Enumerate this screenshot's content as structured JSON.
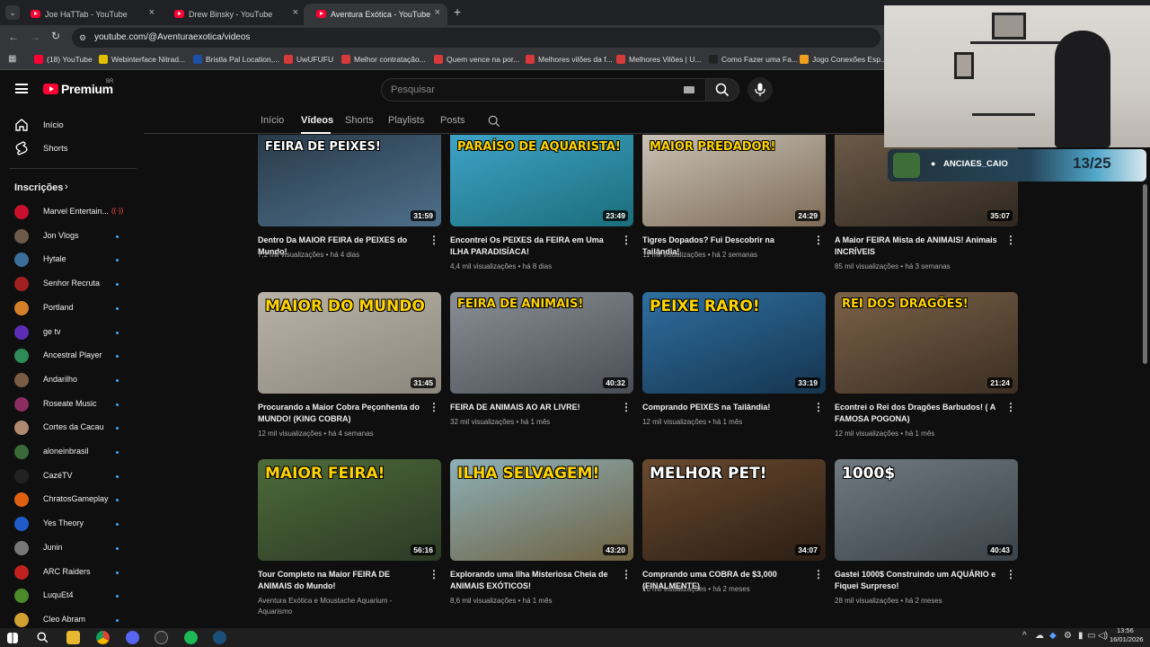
{
  "browser": {
    "tabs": [
      {
        "title": "Joe HaTTab - YouTube"
      },
      {
        "title": "Drew Binsky - YouTube"
      },
      {
        "title": "Aventura Exótica - YouTube"
      }
    ],
    "url": "youtube.com/@Aventuraexotica/videos",
    "bookmarks": [
      {
        "label": "(18) YouTube",
        "color": "#ff0033"
      },
      {
        "label": "Webinterface Nitrad...",
        "color": "#e0c000"
      },
      {
        "label": "Bristla Pal Location,...",
        "color": "#1e4fa5"
      },
      {
        "label": "UwUFUFU",
        "color": "#d63a3a"
      },
      {
        "label": "Melhor contratação...",
        "color": "#d63a3a"
      },
      {
        "label": "Quem vence na por...",
        "color": "#d63a3a"
      },
      {
        "label": "Melhores vilões da f...",
        "color": "#d63a3a"
      },
      {
        "label": "Melhores Vilões | U...",
        "color": "#d63a3a"
      },
      {
        "label": "Como Fazer uma Fa...",
        "color": "#222222"
      },
      {
        "label": "Jogo Conexões Esp...",
        "color": "#f0a020"
      }
    ]
  },
  "youtube": {
    "logo": "Premium",
    "logo_region": "BR",
    "search_placeholder": "Pesquisar",
    "sidebar": {
      "home": "Início",
      "shorts": "Shorts",
      "subscriptions_header": "Inscrições",
      "channels": [
        {
          "name": "Marvel Entertain...",
          "color": "#c8102e",
          "live": true
        },
        {
          "name": "Jon Vlogs",
          "color": "#6b5a4a",
          "live": false
        },
        {
          "name": "Hytale",
          "color": "#3c6e9c",
          "live": false
        },
        {
          "name": "Senhor Recruta",
          "color": "#a32020",
          "live": false
        },
        {
          "name": "Portland",
          "color": "#d4802a",
          "live": false
        },
        {
          "name": "ge tv",
          "color": "#5b2db5",
          "live": false
        },
        {
          "name": "Ancestral Player",
          "color": "#2e8b57",
          "live": false
        },
        {
          "name": "Andarilho",
          "color": "#7a5c45",
          "live": false
        },
        {
          "name": "Roseate Music",
          "color": "#8a2d5e",
          "live": false
        },
        {
          "name": "Cortes da Cacau",
          "color": "#b08a70",
          "live": false
        },
        {
          "name": "aloneinbrasil",
          "color": "#3a6a3a",
          "live": false
        },
        {
          "name": "CazéTV",
          "color": "#222222",
          "live": false
        },
        {
          "name": "ChratosGameplay",
          "color": "#e06010",
          "live": false
        },
        {
          "name": "Yes Theory",
          "color": "#1f5cc9",
          "live": false
        },
        {
          "name": "Junin",
          "color": "#777777",
          "live": false
        },
        {
          "name": "ARC Raiders",
          "color": "#c02020",
          "live": false
        },
        {
          "name": "LuquEt4",
          "color": "#4a8a2a",
          "live": false
        },
        {
          "name": "Cleo Abram",
          "color": "#d0a030",
          "live": false
        }
      ]
    },
    "channel_tabs": [
      "Início",
      "Vídeos",
      "Shorts",
      "Playlists",
      "Posts"
    ],
    "videos": [
      {
        "title": "Dentro Da MAIOR FEIRA de PEIXES do Mundo!",
        "views": "7,2 mil visualizações",
        "age": "há 4 dias",
        "duration": "31:59",
        "overlay": "FEIRA DE PEIXES!",
        "bg": [
          "#2a3b4a",
          "#4d6f8a"
        ]
      },
      {
        "title": "Encontrei Os PEIXES da FEIRA em Uma ILHA PARADISÍACA!",
        "views": "4,4 mil visualizações",
        "age": "há 8 dias",
        "duration": "23:49",
        "overlay": "PARAÍSO DE AQUARISTA!",
        "bg": [
          "#3ea3c7",
          "#1b6d7a"
        ]
      },
      {
        "title": "Tigres Dopados? Fui Descobrir na Tailândia!",
        "views": "11 mil visualizações",
        "age": "há 2 semanas",
        "duration": "24:29",
        "overlay": "MAIOR PREDADOR!",
        "bg": [
          "#c9c2b6",
          "#7d6a55"
        ]
      },
      {
        "title": "A Maior FEIRA Mista de ANIMAIS! Animais INCRÍVEIS",
        "views": "85 mil visualizações",
        "age": "há 3 semanas",
        "duration": "35:07",
        "overlay": "",
        "bg": [
          "#6b5a48",
          "#2f2720"
        ]
      },
      {
        "title": "Procurando a Maior Cobra Peçonhenta do MUNDO! (KING COBRA)",
        "views": "12 mil visualizações",
        "age": "há 4 semanas",
        "duration": "31:45",
        "overlay": "MAIOR DO MUNDO",
        "bg": [
          "#b9b3a7",
          "#8c877d"
        ]
      },
      {
        "title": "FEIRA DE ANIMAIS AO AR LIVRE!",
        "views": "32 mil visualizações",
        "age": "há 1 mês",
        "duration": "40:32",
        "overlay": "FEIRA DE ANIMAIS!",
        "bg": [
          "#8a8f96",
          "#4a4e54"
        ]
      },
      {
        "title": "Comprando PEIXES na Tailândia!",
        "views": "12 mil visualizações",
        "age": "há 1 mês",
        "duration": "33:19",
        "overlay": "PEIXE RARO!",
        "bg": [
          "#2f6fa0",
          "#15344e"
        ]
      },
      {
        "title": "Econtrei o Rei dos Dragões Barbudos! ( A FAMOSA POGONA)",
        "views": "12 mil visualizações",
        "age": "há 1 mês",
        "duration": "21:24",
        "overlay": "REI DOS DRAGÕES!",
        "bg": [
          "#7a6148",
          "#3c2e22"
        ]
      },
      {
        "title": "Tour Completo na Maior FEIRA DE ANIMAIS do Mundo!",
        "views": "Aventura Exótica e Moustache Aquarium - Aquarismo",
        "age": "",
        "duration": "56:16",
        "overlay": "MAIOR FEIRA!",
        "bg": [
          "#4d6b3a",
          "#2c3a25"
        ]
      },
      {
        "title": "Explorando uma Ilha Misteriosa Cheia de ANIMAIS EXÓTICOS!",
        "views": "8,6 mil visualizações",
        "age": "há 1 mês",
        "duration": "43:20",
        "overlay": "ILHA SELVAGEM!",
        "bg": [
          "#8db0b8",
          "#6e6040"
        ]
      },
      {
        "title": "Comprando uma COBRA de $3,000 (FINALMENTE)",
        "views": "16 mil visualizações",
        "age": "há 2 meses",
        "duration": "34:07",
        "overlay": "MELHOR PET!",
        "bg": [
          "#6a4a2e",
          "#2b1d14"
        ]
      },
      {
        "title": "Gastei 1000$ Construindo um AQUÁRIO e Fiquei Surpreso!",
        "views": "28 mil visualizações",
        "age": "há 2 meses",
        "duration": "40:43",
        "overlay": "1000$",
        "bg": [
          "#6f7a80",
          "#3a4248"
        ]
      }
    ]
  },
  "overlay": {
    "handle": "ANCIAES_CAIO",
    "counter": "13/25"
  },
  "taskbar": {
    "time": "13:56",
    "date": "16/01/2026"
  }
}
